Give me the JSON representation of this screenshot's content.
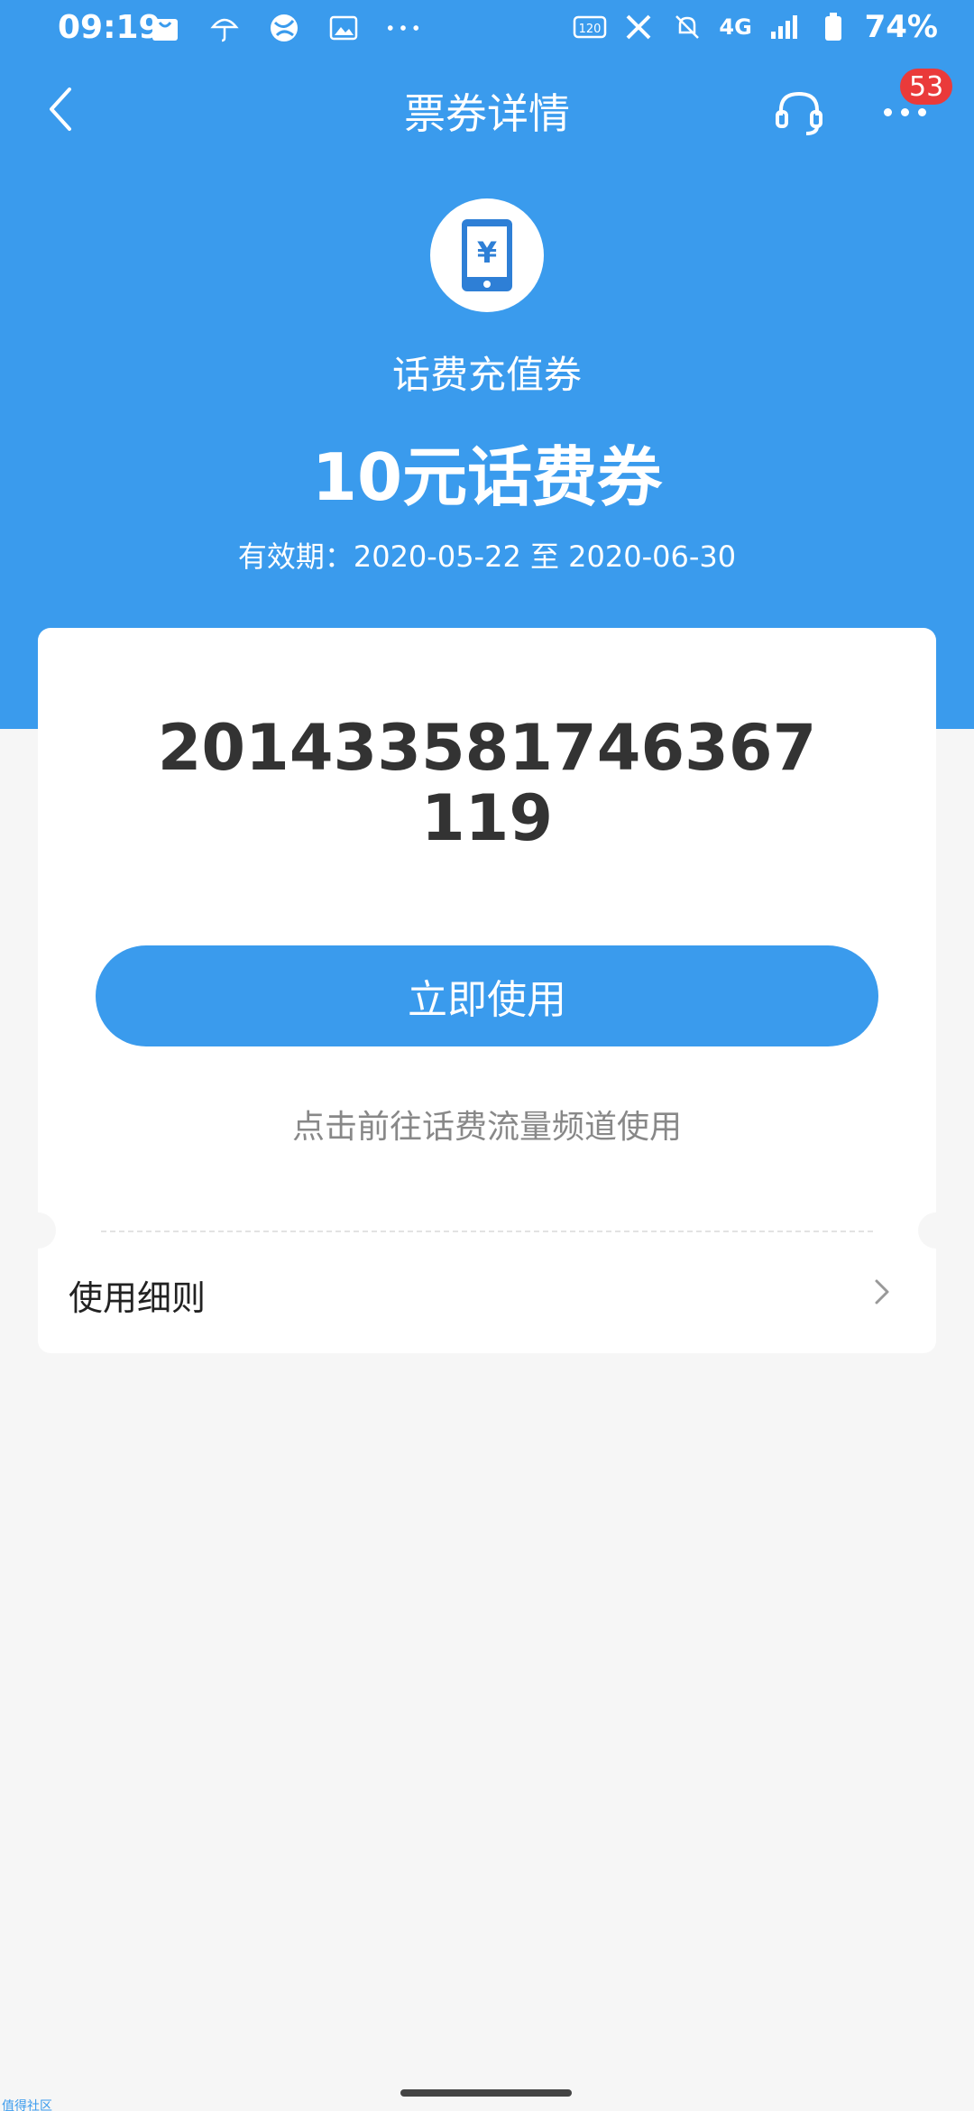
{
  "status_bar": {
    "time": "09:19",
    "battery": "74%",
    "network": "4G",
    "left_icons": [
      "shopping-bag-icon",
      "umbrella-icon",
      "globe-icon",
      "image-icon",
      "more-dots-icon"
    ],
    "right_icons": [
      "hd-icon",
      "x-icon",
      "mute-icon",
      "signal-icon",
      "battery-icon"
    ]
  },
  "nav": {
    "title": "票券详情",
    "badge_count": "53"
  },
  "voucher": {
    "type": "话费充值券",
    "title": "10元话费券",
    "validity": "有效期：2020-05-22 至 2020-06-30",
    "code": "201433581746367119",
    "use_button": "立即使用",
    "hint": "点击前往话费流量频道使用",
    "rules_label": "使用细则"
  },
  "footer": {
    "watermark": "值得社区"
  },
  "colors": {
    "primary": "#3a9bed",
    "badge": "#ea3a3a",
    "background": "#f6f6f6"
  }
}
